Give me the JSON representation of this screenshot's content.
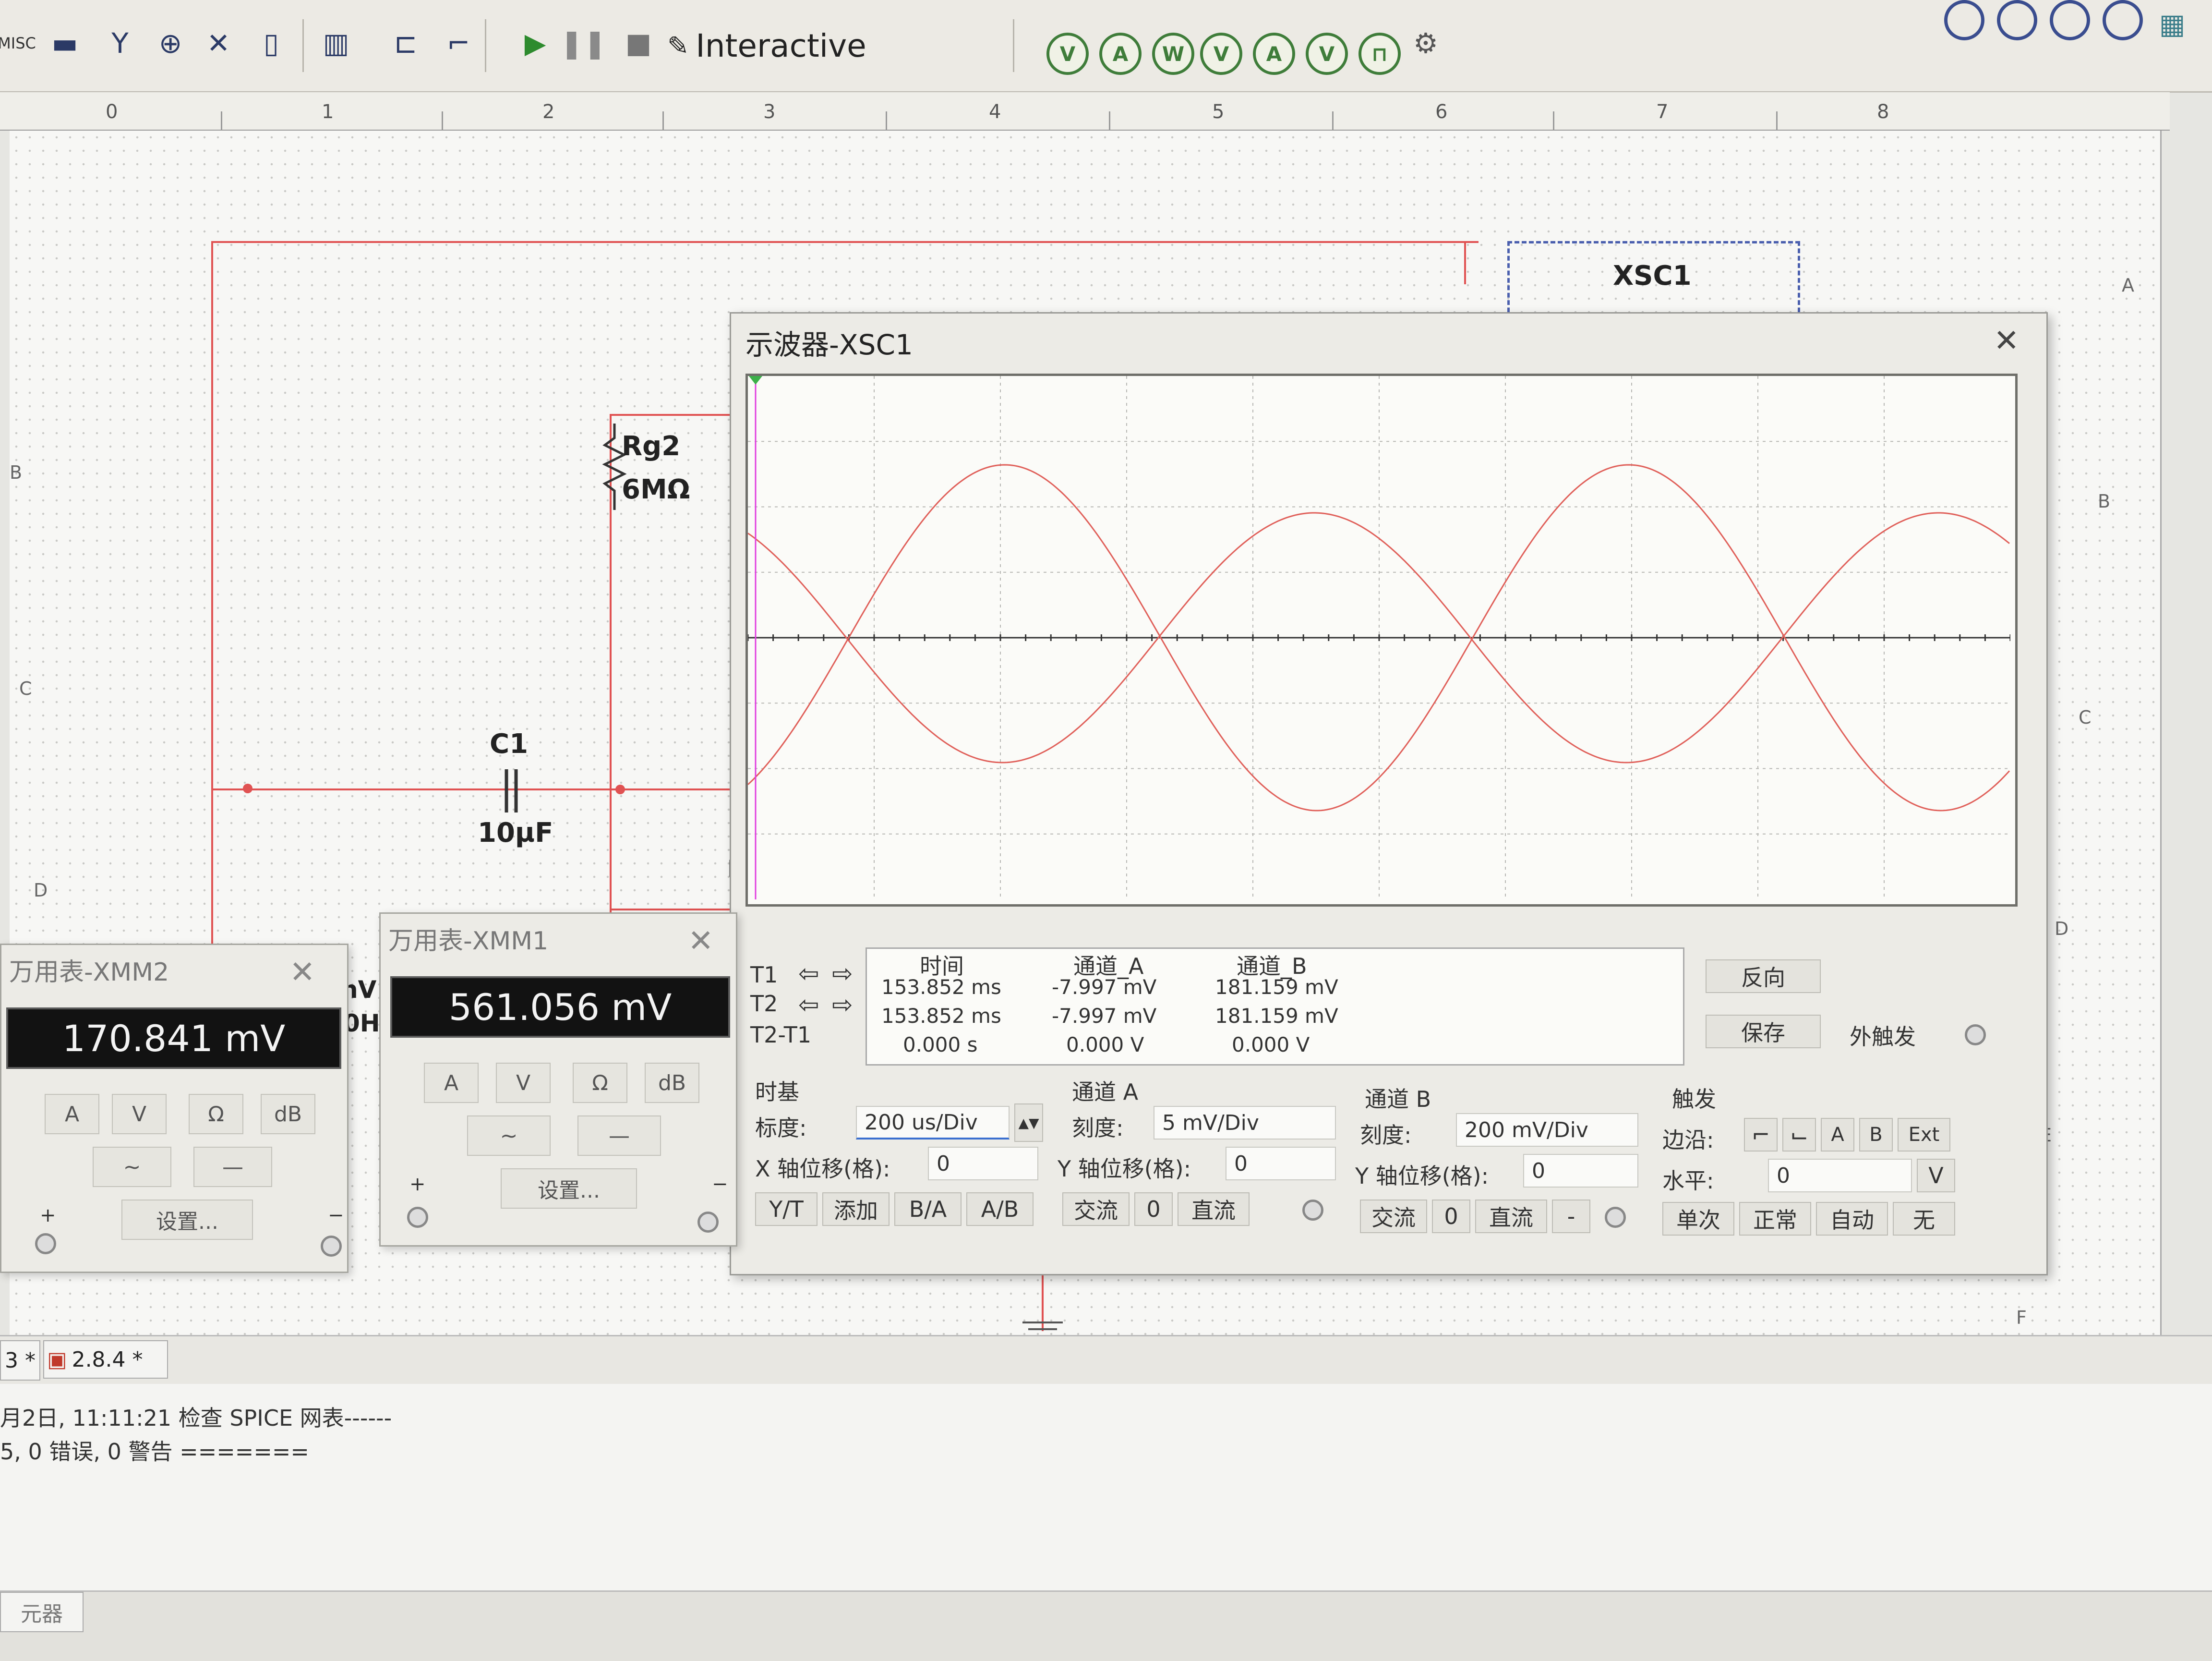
{
  "toolbar": {
    "misc_label": "MISC",
    "interactive_label": "Interactive"
  },
  "ruler": {
    "numbers": [
      "0",
      "1",
      "2",
      "3",
      "4",
      "5",
      "6",
      "7",
      "8"
    ]
  },
  "sheet_rows": {
    "left": [
      "B",
      "C",
      "D"
    ],
    "right": [
      "A",
      "B",
      "C",
      "D",
      "E",
      "F"
    ]
  },
  "schematic": {
    "rg2_name": "Rg2",
    "rg2_value": "6MΩ",
    "c1_name": "C1",
    "c1_value": "10µF",
    "xsc1_label": "XSC1",
    "partial_r": "R",
    "partial_v": "nV",
    "partial_h": "0H"
  },
  "scope": {
    "title": "示波器-XSC1",
    "readout": {
      "headers": [
        "时间",
        "通道_A",
        "通道_B"
      ],
      "rows": [
        {
          "label": "T1",
          "time": "153.852 ms",
          "a": "-7.997 mV",
          "b": "181.159 mV"
        },
        {
          "label": "T2",
          "time": "153.852 ms",
          "a": "-7.997 mV",
          "b": "181.159 mV"
        },
        {
          "label": "T2-T1",
          "time": "0.000 s",
          "a": "0.000 V",
          "b": "0.000 V"
        }
      ]
    },
    "reverse_button": "反向",
    "save_button": "保存",
    "ext_trigger_label": "外触发",
    "timebase": {
      "title": "时基",
      "scale_label": "标度:",
      "scale_value": "200 us/Div",
      "xpos_label": "X 轴位移(格):",
      "xpos_value": "0",
      "buttons": [
        "Y/T",
        "添加",
        "B/A",
        "A/B"
      ]
    },
    "channel_a": {
      "title": "通道 A",
      "scale_label": "刻度:",
      "scale_value": "5 mV/Div",
      "ypos_label": "Y 轴位移(格):",
      "ypos_value": "0",
      "coupling": [
        "交流",
        "0",
        "直流"
      ]
    },
    "channel_b": {
      "title": "通道 B",
      "scale_label": "刻度:",
      "scale_value": "200 mV/Div",
      "ypos_label": "Y 轴位移(格):",
      "ypos_value": "0",
      "coupling": [
        "交流",
        "0",
        "直流",
        "-"
      ]
    },
    "trigger": {
      "title": "触发",
      "edge_label": "边沿:",
      "edge_buttons": [
        "A",
        "B",
        "Ext"
      ],
      "level_label": "水平:",
      "level_value": "0",
      "level_unit": "V",
      "mode_buttons": [
        "单次",
        "正常",
        "自动",
        "无"
      ]
    },
    "trace_color": "#e0605a"
  },
  "dmm2": {
    "title": "万用表-XMM2",
    "reading": "170.841 mV",
    "mode_buttons": [
      "A",
      "V",
      "Ω",
      "dB"
    ],
    "settings_button": "设置...",
    "plus": "+",
    "minus": "−"
  },
  "dmm1": {
    "title": "万用表-XMM1",
    "reading": "561.056 mV",
    "mode_buttons": [
      "A",
      "V",
      "Ω",
      "dB"
    ],
    "settings_button": "设置...",
    "plus": "+",
    "minus": "−"
  },
  "tabs": [
    {
      "label": "3 *"
    },
    {
      "label": "2.8.4 *"
    }
  ],
  "output_log": [
    "月2日, 11:11:21 检查 SPICE 网表------",
    "5, 0 错误, 0 警告 ======="
  ],
  "bottom_tab": "元器",
  "colors": {
    "wire": "#e05252",
    "dmm_display_bg": "#121212",
    "toolbar_bg": "#eceae4"
  }
}
